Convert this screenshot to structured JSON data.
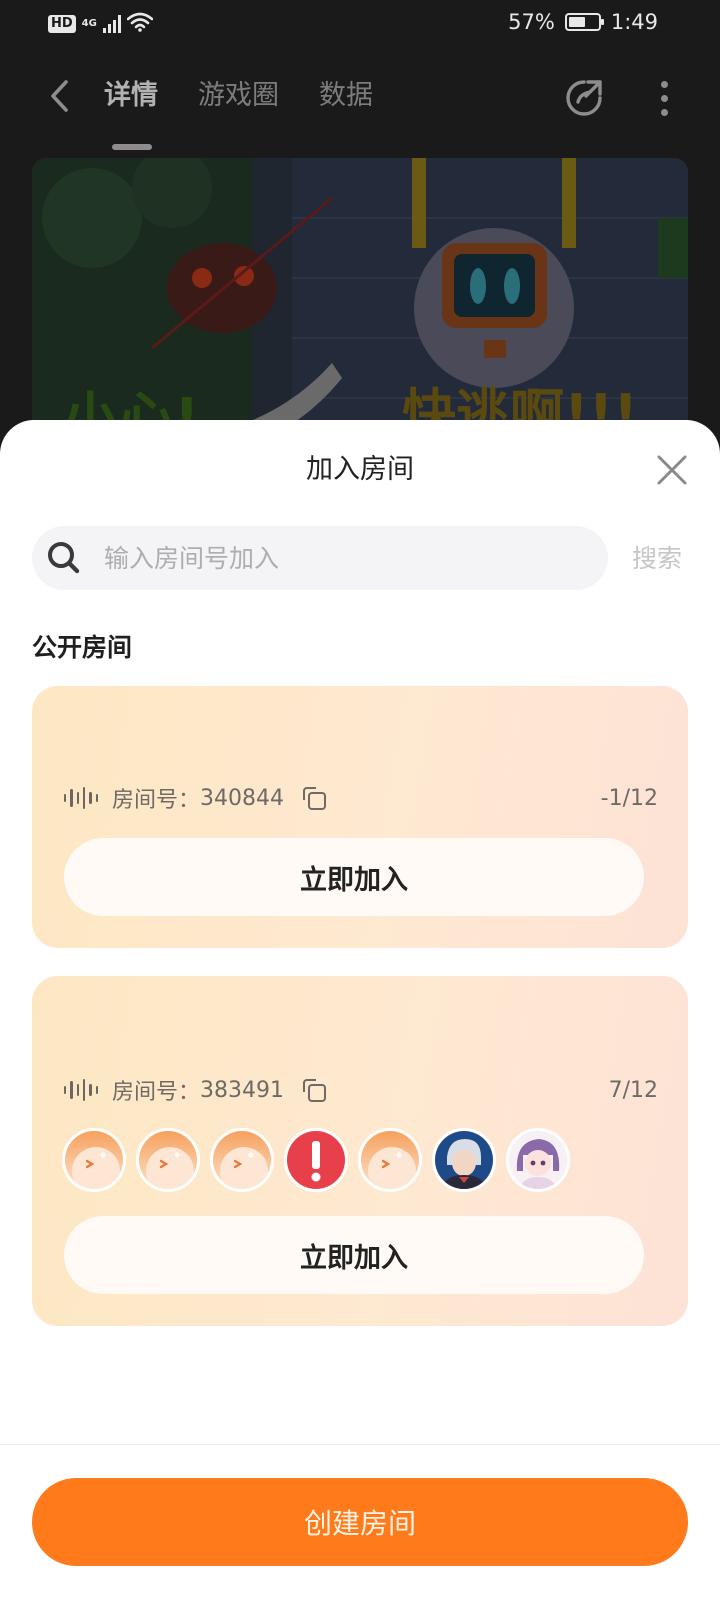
{
  "status_bar": {
    "hd": "HD",
    "network": "4G",
    "battery_percent": "57%",
    "battery_level": 0.57,
    "time": "1:49"
  },
  "nav": {
    "tabs": [
      {
        "label": "详情",
        "active": true
      },
      {
        "label": "游戏圈",
        "active": false
      },
      {
        "label": "数据",
        "active": false
      }
    ]
  },
  "banner": {
    "left_text": "小心!",
    "right_text": "快逃啊!!!"
  },
  "sheet": {
    "title": "加入房间",
    "search_placeholder": "输入房间号加入",
    "search_button": "搜索",
    "section_title": "公开房间",
    "rooms": [
      {
        "label": "房间号：",
        "number": "340844",
        "count": "-1/12",
        "join": "立即加入"
      },
      {
        "label": "房间号：",
        "number": "383491",
        "count": "7/12",
        "join": "立即加入"
      }
    ],
    "create_button": "创建房间"
  },
  "colors": {
    "accent": "#ff7a1a",
    "card_gradient_start": "#fde7c3",
    "card_gradient_end": "#fde2d6"
  }
}
